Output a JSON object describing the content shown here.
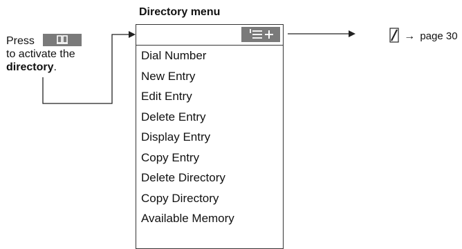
{
  "title": "Directory menu",
  "instruction": {
    "press": "Press",
    "line2": "to activate the",
    "bold_word": "directory",
    "period": "."
  },
  "softkey_icons": {
    "instruction_key": "book-icon",
    "menu_key": "list-add-icon"
  },
  "menu_items": [
    "Dial Number",
    "New Entry",
    "Edit Entry",
    "Delete Entry",
    "Display Entry",
    "Copy Entry",
    "Delete Directory",
    "Copy Directory",
    "Available Memory"
  ],
  "reference": {
    "icon": "pen-edit-icon",
    "arrow": "→",
    "text": "page 30"
  },
  "colors": {
    "softkey": "#7a7a7a",
    "line": "#333333"
  }
}
